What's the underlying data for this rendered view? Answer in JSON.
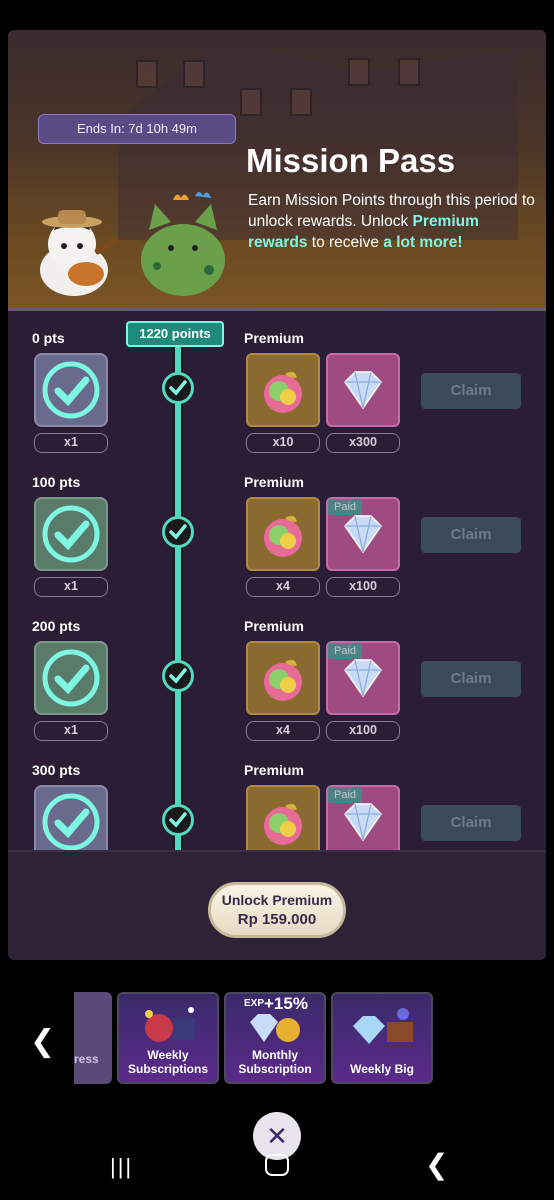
{
  "banner": {
    "timer": "Ends In: 7d 10h 49m",
    "title": "Mission Pass",
    "desc_1": "Earn Mission Points through this period to unlock rewards. Unlock ",
    "desc_hl1": "Premium rewards",
    "desc_2": " to receive ",
    "desc_hl2": "a lot more!"
  },
  "progress": {
    "points_label": "1220 points"
  },
  "tiers": [
    {
      "pts": "0 pts",
      "premium": "Premium",
      "free_qty": "x1",
      "apple_qty": "x10",
      "gem_qty": "x300",
      "paid": "",
      "claim": "Claim"
    },
    {
      "pts": "100 pts",
      "premium": "Premium",
      "free_qty": "x1",
      "apple_qty": "x4",
      "gem_qty": "x100",
      "paid": "Paid",
      "claim": "Claim"
    },
    {
      "pts": "200 pts",
      "premium": "Premium",
      "free_qty": "x1",
      "apple_qty": "x4",
      "gem_qty": "x100",
      "paid": "Paid",
      "claim": "Claim"
    },
    {
      "pts": "300 pts",
      "premium": "Premium",
      "free_qty": "",
      "apple_qty": "",
      "gem_qty": "",
      "paid": "Paid",
      "claim": "Claim"
    }
  ],
  "footer": {
    "unlock_line1": "Unlock Premium",
    "unlock_line2": "Rp 159.000"
  },
  "carousel": {
    "partial_label": "ress",
    "cards": [
      {
        "label": "Weekly Subscriptions"
      },
      {
        "label": "Monthly Subscription",
        "badge": "+15%",
        "badge_prefix": "EXP"
      },
      {
        "label": "Weekly Big"
      }
    ]
  },
  "colors": {
    "accent": "#54d8bf",
    "panel": "#2a1d35",
    "highlight": "#7ef7e2"
  }
}
